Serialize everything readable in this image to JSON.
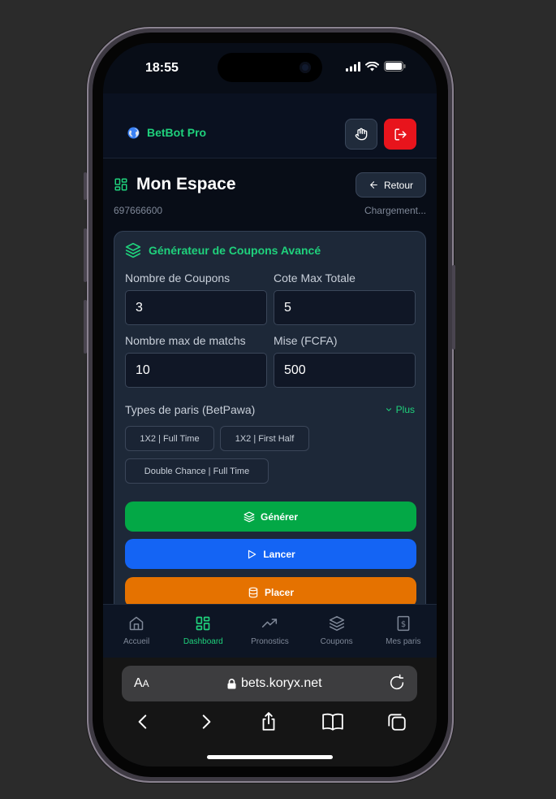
{
  "status": {
    "time": "18:55"
  },
  "header": {
    "brand": "BetBot Pro"
  },
  "page": {
    "title": "Mon Espace",
    "back_label": "Retour",
    "phone": "697666600",
    "loading": "Chargement..."
  },
  "generator": {
    "title": "Générateur de Coupons Avancé",
    "fields": {
      "coupons": {
        "label": "Nombre de Coupons",
        "value": "3"
      },
      "cote_max": {
        "label": "Cote Max Totale",
        "value": "5"
      },
      "max_matchs": {
        "label": "Nombre max de matchs",
        "value": "10"
      },
      "mise": {
        "label": "Mise (FCFA)",
        "value": "500"
      }
    },
    "types_label": "Types de paris (BetPawa)",
    "plus_label": "Plus",
    "chips": [
      "1X2 | Full Time",
      "1X2 | First Half",
      "Double Chance | Full Time"
    ],
    "buttons": {
      "generate": "Générer",
      "launch": "Lancer",
      "place": "Placer"
    }
  },
  "nav": {
    "items": [
      {
        "label": "Accueil",
        "icon": "home-icon"
      },
      {
        "label": "Dashboard",
        "icon": "grid-icon"
      },
      {
        "label": "Pronostics",
        "icon": "trend-icon"
      },
      {
        "label": "Coupons",
        "icon": "layers-icon"
      },
      {
        "label": "Mes paris",
        "icon": "dollar-icon"
      }
    ],
    "active": "Dashboard"
  },
  "browser": {
    "aa_big": "A",
    "aa_small": "A",
    "url": "bets.koryx.net"
  },
  "colors": {
    "accent": "#1fd17c",
    "generate": "#03a846",
    "launch": "#1464f4",
    "place": "#e57200",
    "logout": "#e8141c"
  }
}
